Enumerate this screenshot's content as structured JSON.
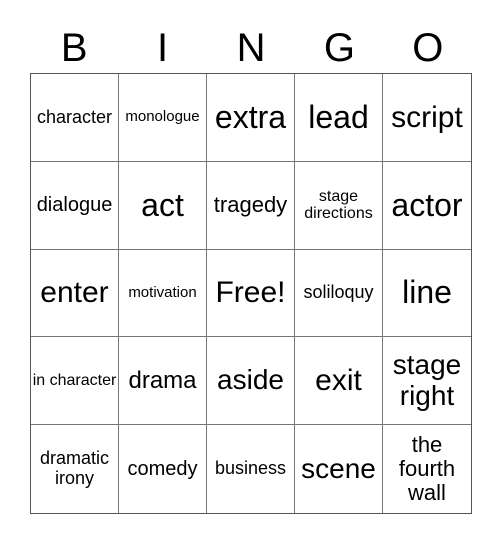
{
  "header": {
    "letters": [
      "B",
      "I",
      "N",
      "G",
      "O"
    ]
  },
  "grid": {
    "rows": [
      [
        "character",
        "monologue",
        "extra",
        "lead",
        "script"
      ],
      [
        "dialogue",
        "act",
        "tragedy",
        "stage directions",
        "actor"
      ],
      [
        "enter",
        "motivation",
        "Free!",
        "soliloquy",
        "line"
      ],
      [
        "in character",
        "drama",
        "aside",
        "exit",
        "stage right"
      ],
      [
        "dramatic irony",
        "comedy",
        "business",
        "scene",
        "the fourth wall"
      ]
    ]
  }
}
